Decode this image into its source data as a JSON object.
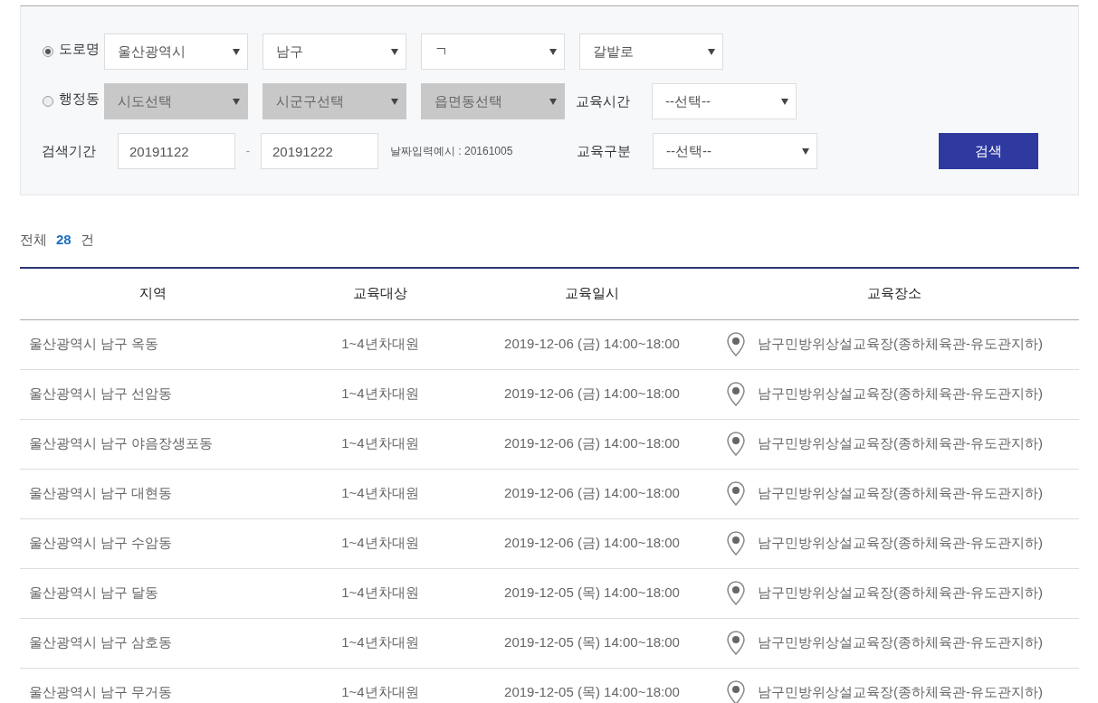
{
  "search": {
    "address_type": [
      {
        "label": "도로명",
        "selected": true,
        "selects": [
          {
            "value": "울산광역시",
            "disabled": false
          },
          {
            "value": "남구",
            "disabled": false
          },
          {
            "value": "ㄱ",
            "disabled": false
          },
          {
            "value": "갈밭로",
            "disabled": false
          }
        ]
      },
      {
        "label": "행정동",
        "selected": false,
        "selects": [
          {
            "value": "시도선택",
            "disabled": true
          },
          {
            "value": "시군구선택",
            "disabled": true
          },
          {
            "value": "읍면동선택",
            "disabled": true
          }
        ]
      }
    ],
    "education_time": {
      "label": "교육시간",
      "value": "--선택--"
    },
    "period": {
      "label": "검색기간",
      "from": "20191122",
      "separator": "-",
      "to": "20191222",
      "hint": "날짜입력예시 : 20161005"
    },
    "education_type": {
      "label": "교육구분",
      "value": "--선택--"
    },
    "search_button": "검색"
  },
  "total": {
    "prefix": "전체",
    "count": "28",
    "suffix": "건"
  },
  "table": {
    "columns": [
      "지역",
      "교육대상",
      "교육일시",
      "교육장소"
    ],
    "rows": [
      [
        "울산광역시 남구 옥동",
        "1~4년차대원",
        "2019-12-06 (금) 14:00~18:00",
        "남구민방위상설교육장(종하체육관-유도관지하)"
      ],
      [
        "울산광역시 남구 선암동",
        "1~4년차대원",
        "2019-12-06 (금) 14:00~18:00",
        "남구민방위상설교육장(종하체육관-유도관지하)"
      ],
      [
        "울산광역시 남구 야음장생포동",
        "1~4년차대원",
        "2019-12-06 (금) 14:00~18:00",
        "남구민방위상설교육장(종하체육관-유도관지하)"
      ],
      [
        "울산광역시 남구 대현동",
        "1~4년차대원",
        "2019-12-06 (금) 14:00~18:00",
        "남구민방위상설교육장(종하체육관-유도관지하)"
      ],
      [
        "울산광역시 남구 수암동",
        "1~4년차대원",
        "2019-12-06 (금) 14:00~18:00",
        "남구민방위상설교육장(종하체육관-유도관지하)"
      ],
      [
        "울산광역시 남구 달동",
        "1~4년차대원",
        "2019-12-05 (목) 14:00~18:00",
        "남구민방위상설교육장(종하체육관-유도관지하)"
      ],
      [
        "울산광역시 남구 삼호동",
        "1~4년차대원",
        "2019-12-05 (목) 14:00~18:00",
        "남구민방위상설교육장(종하체육관-유도관지하)"
      ],
      [
        "울산광역시 남구 무거동",
        "1~4년차대원",
        "2019-12-05 (목) 14:00~18:00",
        "남구민방위상설교육장(종하체육관-유도관지하)"
      ]
    ]
  }
}
